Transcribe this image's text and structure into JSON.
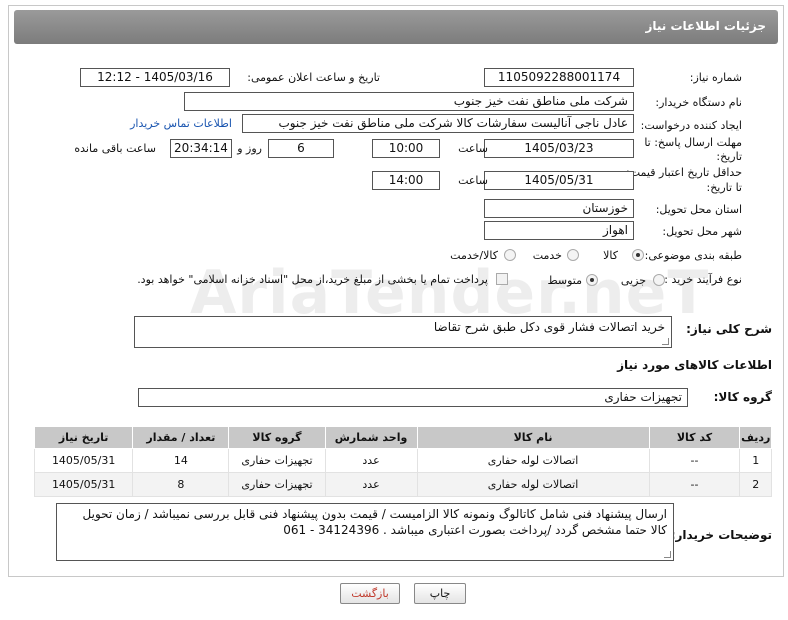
{
  "header": {
    "title": "جزئیات اطلاعات نیاز"
  },
  "fields": {
    "need_number_label": "شماره نیاز:",
    "need_number": "1105092288001174",
    "announce_label": "تاریخ و ساعت اعلان عمومی:",
    "announce_value": "1405/03/16 - 12:12",
    "buyer_org_label": "نام دستگاه خریدار:",
    "buyer_org": "شرکت ملی مناطق نفت خیز جنوب",
    "creator_label": "ایجاد کننده درخواست:",
    "creator": "عادل  ناجی آنالیست سفارشات کالا  شرکت ملی مناطق نفت خیز جنوب",
    "contact_link": "اطلاعات تماس خریدار",
    "deadline_label_1": "مهلت ارسال پاسخ: تا",
    "deadline_label_2": "تاریخ:",
    "deadline_date": "1405/03/23",
    "time_label": "ساعت",
    "deadline_time": "10:00",
    "days_value": "6",
    "days_label": "روز و",
    "remaining_time": "20:34:14",
    "remaining_label": "ساعت باقی مانده",
    "validity_label_1": "حداقل تاریخ اعتبار قیمت:",
    "validity_label_2": "تا تاریخ:",
    "validity_date": "1405/05/31",
    "validity_time": "14:00",
    "province_label": "استان محل تحویل:",
    "province": "خوزستان",
    "city_label": "شهر محل تحویل:",
    "city": "اهواز",
    "category_label": "طبقه بندی موضوعی:",
    "category_options": [
      "کالا",
      "خدمت",
      "کالا/خدمت"
    ],
    "purchase_type_label": "نوع فرآیند خرید :",
    "purchase_options": [
      "جزیی",
      "متوسط"
    ],
    "payment_note": "پرداخت تمام یا بخشی از مبلغ خرید،از محل \"اسناد خزانه اسلامی\" خواهد بود."
  },
  "summary": {
    "label": "شرح کلی نیاز:",
    "text": "خرید اتصالات فشار قوی دکل طبق شرح تقاضا"
  },
  "goods_section": {
    "title": "اطلاعات کالاهای مورد نیاز"
  },
  "goods_group": {
    "label": "گروه کالا:",
    "value": "تجهیزات حفاری"
  },
  "table": {
    "headers": [
      "ردیف",
      "کد کالا",
      "نام کالا",
      "واحد شمارش",
      "گروه کالا",
      "تعداد / مقدار",
      "تاریخ نیاز"
    ],
    "rows": [
      [
        "1",
        "--",
        "اتصالات لوله حفاری",
        "عدد",
        "تجهیزات حفاری",
        "14",
        "1405/05/31"
      ],
      [
        "2",
        "--",
        "اتصالات لوله حفاری",
        "عدد",
        "تجهیزات حفاری",
        "8",
        "1405/05/31"
      ]
    ]
  },
  "buyer_notes": {
    "label": "توضیحات خریدار:",
    "text": "ارسال پیشنهاد فنی  شامل کاتالوگ ونمونه کالا الزامیست / قیمت بدون پیشنهاد فنی قابل بررسی نمیباشد / زمان تحویل کالا حتما مشخص گردد /پرداخت بصورت اعتباری میباشد . 34124396 - 061"
  },
  "buttons": {
    "print": "چاپ",
    "back": "بازگشت"
  },
  "watermark": "AriaTender.neT",
  "colors": {
    "header": "#8a8a8a",
    "link": "#1a55b0",
    "table_header": "#c8c8c8"
  }
}
